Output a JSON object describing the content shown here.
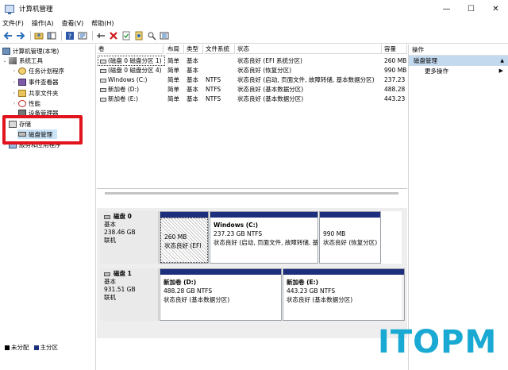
{
  "window": {
    "title": "计算机管理",
    "controls": {
      "minimize": "—",
      "maximize": "☐",
      "close": "✕"
    }
  },
  "menu": [
    "文件(F)",
    "操作(A)",
    "查看(V)",
    "帮助(H)"
  ],
  "toolbar_icons": [
    "back-icon",
    "forward-icon",
    "up-folder-icon",
    "show-tree-icon",
    "help-icon",
    "properties-icon",
    "connect-icon",
    "delete-icon",
    "check-icon",
    "disk-icon",
    "search-icon",
    "disk-list-icon"
  ],
  "tree": {
    "root": "计算机管理(本地)",
    "system_tools": "系统工具",
    "task_scheduler": "任务计划程序",
    "event_viewer": "事件查看器",
    "shared_folders": "共享文件夹",
    "performance": "性能",
    "device_manager": "设备管理器",
    "storage": "存储",
    "disk_management": "磁盘管理",
    "services_apps": "服务和应用程序"
  },
  "volume_table": {
    "headers": [
      "卷",
      "布局",
      "类型",
      "文件系统",
      "状态",
      "容量"
    ],
    "rows": [
      [
        "(磁盘 0 磁盘分区 1)",
        "简单",
        "基本",
        "",
        "状态良好 (EFI 系统分区)",
        "260 MB"
      ],
      [
        "(磁盘 0 磁盘分区 4)",
        "简单",
        "基本",
        "",
        "状态良好 (恢复分区)",
        "990 MB"
      ],
      [
        "Windows (C:)",
        "简单",
        "基本",
        "NTFS",
        "状态良好 (启动, 页面文件, 故障转储, 基本数据分区)",
        "237.23"
      ],
      [
        "新加卷 (D:)",
        "简单",
        "基本",
        "NTFS",
        "状态良好 (基本数据分区)",
        "488.28"
      ],
      [
        "新加卷 (E:)",
        "简单",
        "基本",
        "NTFS",
        "状态良好 (基本数据分区)",
        "443.23"
      ]
    ]
  },
  "disks": [
    {
      "name": "磁盘 0",
      "type": "基本",
      "size": "238.46 GB",
      "status": "联机",
      "partitions": [
        {
          "title": "",
          "size": "260 MB",
          "status": "状态良好 (EFI"
        },
        {
          "title": "Windows  (C:)",
          "size": "237.23 GB NTFS",
          "status": "状态良好 (启动, 页面文件, 故障转储, 基"
        },
        {
          "title": "",
          "size": "990 MB",
          "status": "状态良好 (恢复分区)"
        }
      ]
    },
    {
      "name": "磁盘 1",
      "type": "基本",
      "size": "931.51 GB",
      "status": "联机",
      "partitions": [
        {
          "title": "新加卷  (D:)",
          "size": "488.28 GB NTFS",
          "status": "状态良好 (基本数据分区)"
        },
        {
          "title": "新加卷  (E:)",
          "size": "443.23 GB NTFS",
          "status": "状态良好 (基本数据分区)"
        }
      ]
    }
  ],
  "legend": {
    "unallocated": "未分配",
    "primary": "主分区",
    "unallocated_color": "#000000",
    "primary_color": "#1d2f7c"
  },
  "actions": {
    "header": "操作",
    "section": "磁盘管理",
    "more": "更多操作"
  },
  "watermark": "ITOPM",
  "colors": {
    "accent": "#1d2f7c",
    "highlight_box": "#e1131c",
    "watermark": "#1aa9d2"
  }
}
